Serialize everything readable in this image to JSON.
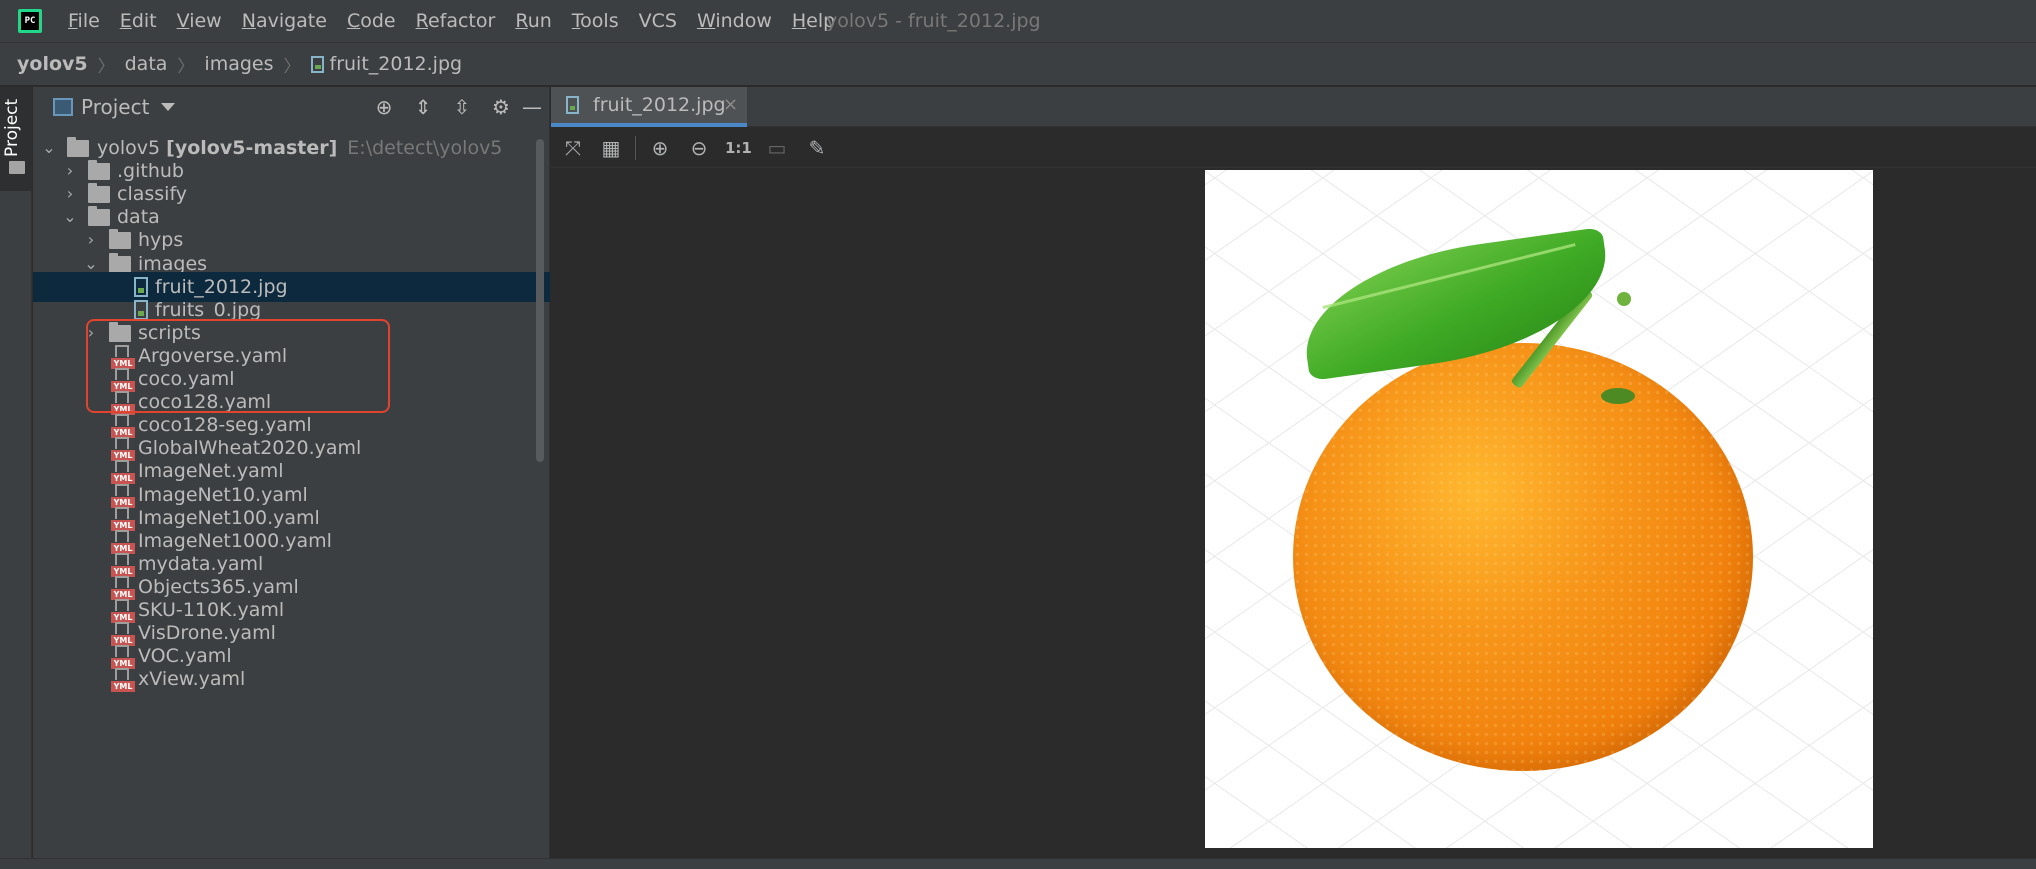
{
  "app": {
    "logo_text": "PC",
    "window_title": "yolov5 - fruit_2012.jpg"
  },
  "menu": [
    {
      "mnemonic": "F",
      "rest": "ile"
    },
    {
      "mnemonic": "E",
      "rest": "dit"
    },
    {
      "mnemonic": "V",
      "rest": "iew"
    },
    {
      "mnemonic": "N",
      "rest": "avigate"
    },
    {
      "mnemonic": "C",
      "rest": "ode"
    },
    {
      "mnemonic": "R",
      "rest": "efactor"
    },
    {
      "mnemonic": "R",
      "rest": "un"
    },
    {
      "mnemonic": "T",
      "rest": "ools"
    },
    {
      "mnemonic": "",
      "rest": "VCS"
    },
    {
      "mnemonic": "W",
      "rest": "indow"
    },
    {
      "mnemonic": "H",
      "rest": "elp"
    }
  ],
  "breadcrumb": [
    "yolov5",
    "data",
    "images",
    "fruit_2012.jpg"
  ],
  "tool_strip": {
    "project_label": "Project"
  },
  "project_panel": {
    "title": "Project",
    "header_icons": [
      "locate-icon",
      "expand-all-icon",
      "collapse-all-icon",
      "gear-icon",
      "minimize-icon"
    ]
  },
  "tree": {
    "root": {
      "name": "yolov5",
      "module": "[yolov5-master]",
      "path": "E:\\detect\\yolov5"
    },
    "items": [
      {
        "label": ".github",
        "kind": "folder",
        "state": "collapsed"
      },
      {
        "label": "classify",
        "kind": "folder",
        "state": "collapsed"
      },
      {
        "label": "data",
        "kind": "folder",
        "state": "expanded"
      },
      {
        "label": "hyps",
        "kind": "folder",
        "state": "collapsed"
      },
      {
        "label": "images",
        "kind": "folder",
        "state": "expanded"
      },
      {
        "label": "fruit_2012.jpg",
        "kind": "image",
        "selected": true
      },
      {
        "label": "fruits_0.jpg",
        "kind": "image"
      },
      {
        "label": "scripts",
        "kind": "folder",
        "state": "collapsed"
      },
      {
        "label": "Argoverse.yaml",
        "kind": "yaml"
      },
      {
        "label": "coco.yaml",
        "kind": "yaml"
      },
      {
        "label": "coco128.yaml",
        "kind": "yaml"
      },
      {
        "label": "coco128-seg.yaml",
        "kind": "yaml"
      },
      {
        "label": "GlobalWheat2020.yaml",
        "kind": "yaml"
      },
      {
        "label": "ImageNet.yaml",
        "kind": "yaml"
      },
      {
        "label": "ImageNet10.yaml",
        "kind": "yaml"
      },
      {
        "label": "ImageNet100.yaml",
        "kind": "yaml"
      },
      {
        "label": "ImageNet1000.yaml",
        "kind": "yaml"
      },
      {
        "label": "mydata.yaml",
        "kind": "yaml"
      },
      {
        "label": "Objects365.yaml",
        "kind": "yaml"
      },
      {
        "label": "SKU-110K.yaml",
        "kind": "yaml"
      },
      {
        "label": "VisDrone.yaml",
        "kind": "yaml"
      },
      {
        "label": "VOC.yaml",
        "kind": "yaml"
      },
      {
        "label": "xView.yaml",
        "kind": "yaml"
      }
    ],
    "yml_tag": "YML"
  },
  "editor": {
    "tab_label": "fruit_2012.jpg",
    "tab_close": "×",
    "toolbar": {
      "fit_icon": "⤧",
      "grid_icon": "▦",
      "zoom_in_icon": "⊕",
      "zoom_out_icon": "⊖",
      "actual_size_label": "1:1",
      "background_icon": "▭",
      "color_picker_icon": "✎"
    }
  },
  "colors": {
    "accent": "#4a88c7",
    "selection": "#0d293e",
    "highlight_box": "#e0432e"
  }
}
